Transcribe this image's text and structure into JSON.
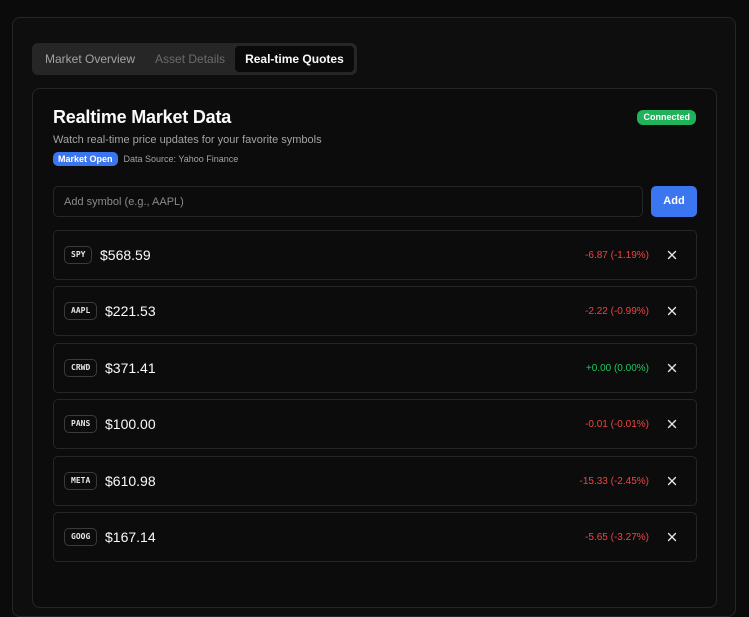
{
  "tabs": [
    {
      "label": "Market Overview",
      "state": "normal"
    },
    {
      "label": "Asset Details",
      "state": "disabled"
    },
    {
      "label": "Real-time Quotes",
      "state": "active"
    }
  ],
  "card": {
    "title": "Realtime Market Data",
    "description": "Watch real-time price updates for your favorite symbols",
    "connection_status": "Connected",
    "market_status": "Market Open",
    "data_source": "Data Source: Yahoo Finance"
  },
  "add_symbol": {
    "placeholder": "Add symbol (e.g., AAPL)",
    "value": "",
    "button_label": "Add"
  },
  "colors": {
    "accent": "#3b76f0",
    "connected": "#21b15b",
    "negative": "#ef4444",
    "positive": "#22c55e"
  },
  "icons": {
    "remove": "close-icon"
  },
  "quotes": [
    {
      "symbol": "SPY",
      "price": "$568.59",
      "change": "-6.87 (-1.19%)",
      "direction": "neg"
    },
    {
      "symbol": "AAPL",
      "price": "$221.53",
      "change": "-2.22 (-0.99%)",
      "direction": "neg"
    },
    {
      "symbol": "CRWD",
      "price": "$371.41",
      "change": "+0.00 (0.00%)",
      "direction": "pos"
    },
    {
      "symbol": "PANS",
      "price": "$100.00",
      "change": "-0.01 (-0.01%)",
      "direction": "neg"
    },
    {
      "symbol": "META",
      "price": "$610.98",
      "change": "-15.33 (-2.45%)",
      "direction": "neg"
    },
    {
      "symbol": "GOOG",
      "price": "$167.14",
      "change": "-5.65 (-3.27%)",
      "direction": "neg"
    }
  ]
}
